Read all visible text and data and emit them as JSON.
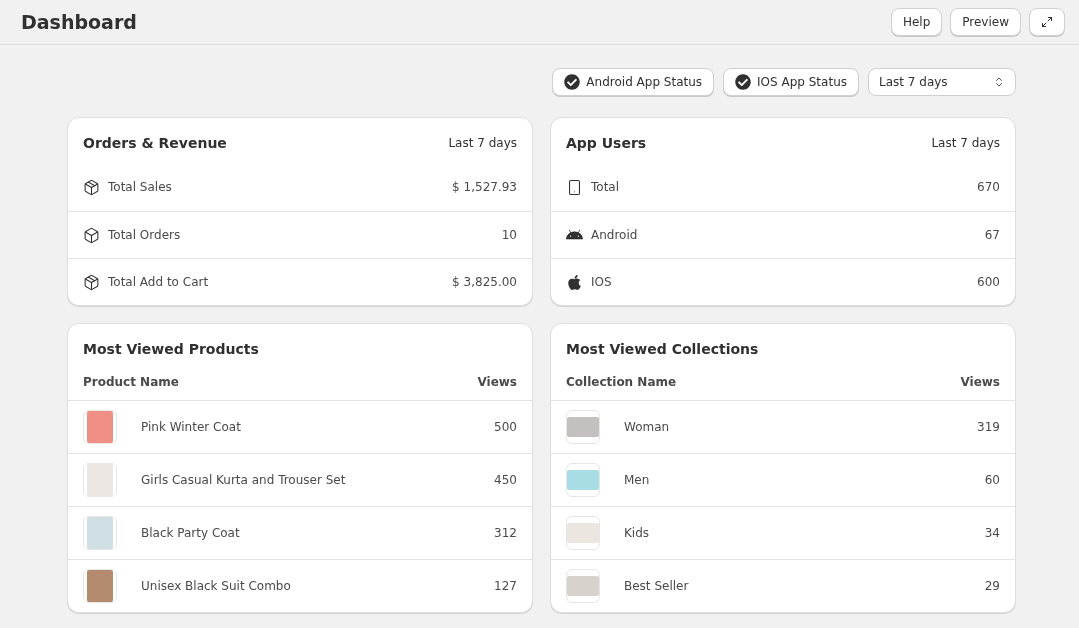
{
  "header": {
    "title": "Dashboard",
    "actions": [
      "Help",
      "Preview"
    ]
  },
  "toolbar": {
    "status_buttons": [
      {
        "label": "Android App Status",
        "checked": true
      },
      {
        "label": "IOS App Status",
        "checked": true
      }
    ],
    "range": {
      "value": "Last 7 days"
    }
  },
  "summary_cards": [
    {
      "title": "Orders & Revenue",
      "period": "Last 7 days",
      "rows": [
        {
          "label": "Total Sales",
          "value": "$ 1,527.93"
        },
        {
          "label": "Total Orders",
          "value": "10"
        },
        {
          "label": "Total Add to Cart",
          "value": "$ 3,825.00"
        }
      ]
    },
    {
      "title": "App Users",
      "period": "Last 7 days",
      "rows": [
        {
          "label": "Total",
          "value": "670"
        },
        {
          "label": "Android",
          "value": "67"
        },
        {
          "label": "IOS",
          "value": "600"
        }
      ]
    }
  ],
  "table_cards": [
    {
      "title": "Most Viewed Products",
      "columns": [
        "Product Name",
        "Views"
      ],
      "rows": [
        {
          "name": "Pink Winter Coat",
          "views": "500"
        },
        {
          "name": "Girls Casual Kurta and Trouser Set",
          "views": "450"
        },
        {
          "name": "Black Party Coat",
          "views": "312"
        },
        {
          "name": "Unisex Black Suit Combo",
          "views": "127"
        }
      ]
    },
    {
      "title": "Most Viewed Collections",
      "columns": [
        "Collection Name",
        "Views"
      ],
      "rows": [
        {
          "name": "Woman",
          "views": "319"
        },
        {
          "name": "Men",
          "views": "60"
        },
        {
          "name": "Kids",
          "views": "34"
        },
        {
          "name": "Best Seller",
          "views": "29"
        }
      ]
    }
  ]
}
